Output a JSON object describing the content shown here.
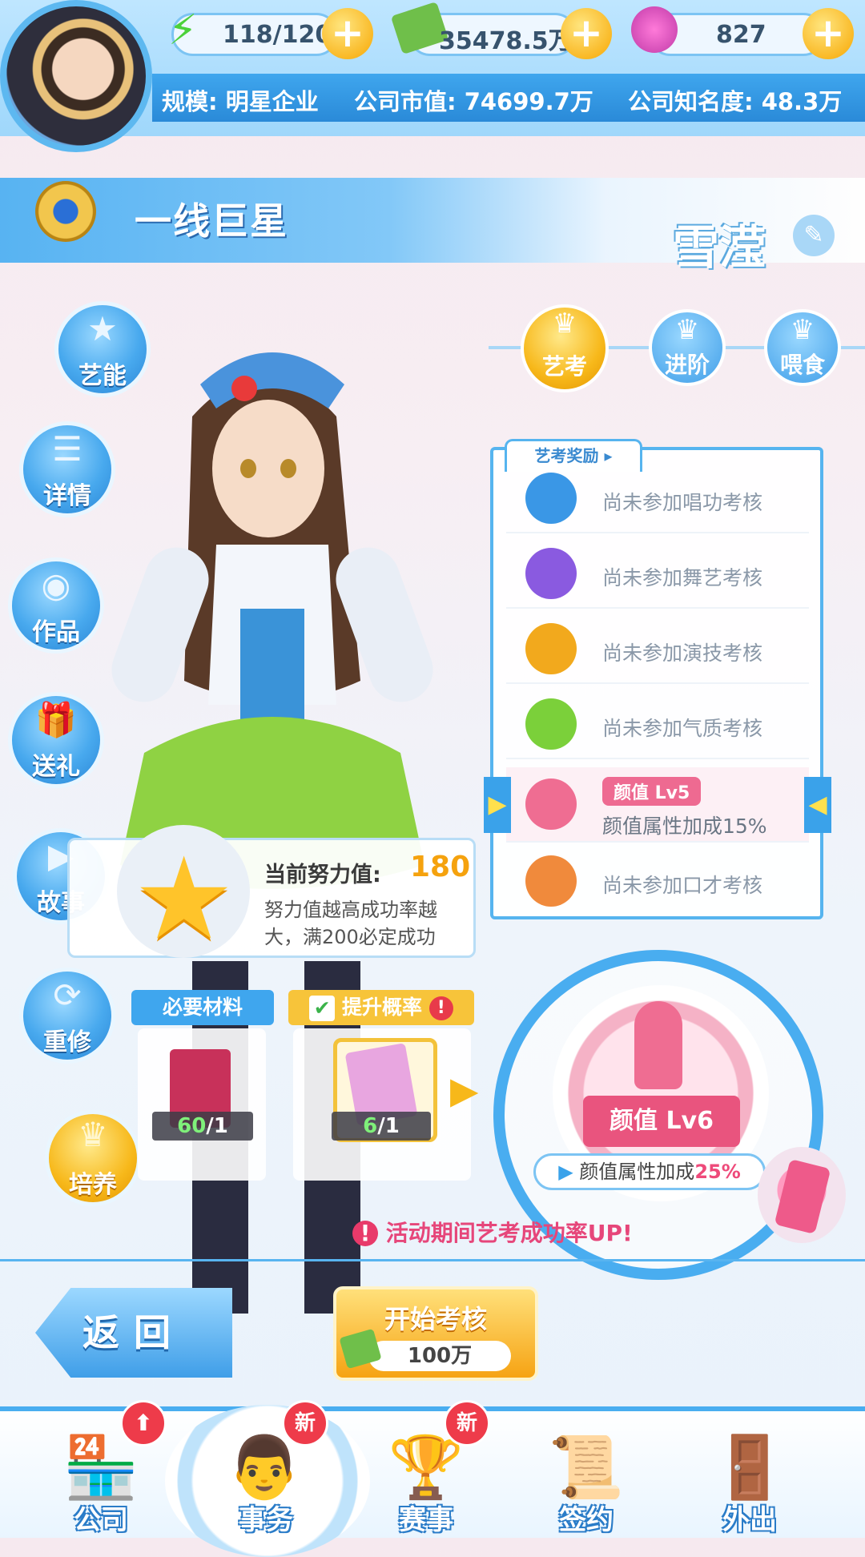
{
  "resources": {
    "stamina": "118/120",
    "cash": "35478.5万",
    "gems": "827"
  },
  "company_info": {
    "scale": "规模: 明星企业",
    "market_value": "公司市值: 74699.7万",
    "fame": "公司知名度: 48.3万"
  },
  "title_bar": {
    "rank": "一线巨星",
    "star_name": "雪滢"
  },
  "side_menu": {
    "skills": "艺能",
    "details": "详情",
    "works": "作品",
    "gift": "送礼",
    "story": "故事",
    "retrain": "重修",
    "cultivate": "培养"
  },
  "tabs": {
    "exam": "艺考",
    "advance": "进阶",
    "feed": "喂食"
  },
  "reward_panel": {
    "title": "艺考奖励",
    "rows": [
      {
        "text": "尚未参加唱功考核",
        "icon": "microphone-icon",
        "color": "#3a97e6"
      },
      {
        "text": "尚未参加舞艺考核",
        "icon": "dance-icon",
        "color": "#8a5ae0"
      },
      {
        "text": "尚未参加演技考核",
        "icon": "clapperboard-icon",
        "color": "#f2a91d"
      },
      {
        "text": "尚未参加气质考核",
        "icon": "flask-icon",
        "color": "#7bd03a"
      },
      {
        "badge": "颜值 Lv5",
        "text": "颜值属性加成15%",
        "icon": "lipstick-icon",
        "color": "#ef6d92"
      },
      {
        "text": "尚未参加口才考核",
        "icon": "bird-icon",
        "color": "#f08a3c"
      }
    ]
  },
  "effort": {
    "label": "当前努力值:",
    "value": "180",
    "desc_line1": "努力值越高成功率越",
    "desc_line2": "大，满200必定成功"
  },
  "materials": {
    "required_label": "必要材料",
    "boost_label": "提升概率",
    "required_count_have": "60",
    "required_count_need": "/1",
    "boost_count_have": "6",
    "boost_count_need": "/1"
  },
  "exam_emblem": {
    "level": "颜值 Lv6",
    "bonus_prefix": "颜值属性加成",
    "bonus_value": "25%"
  },
  "notice": "活动期间艺考成功率UP!",
  "buttons": {
    "back": "返回",
    "start": "开始考核",
    "cost": "100万"
  },
  "bottom_nav": {
    "company": "公司",
    "affairs": "事务",
    "competition": "赛事",
    "sign": "签约",
    "outing": "外出",
    "new_badge": "新"
  },
  "colors": {
    "accent_blue": "#49adf0",
    "gold": "#f6a313",
    "pink": "#e9547e"
  }
}
